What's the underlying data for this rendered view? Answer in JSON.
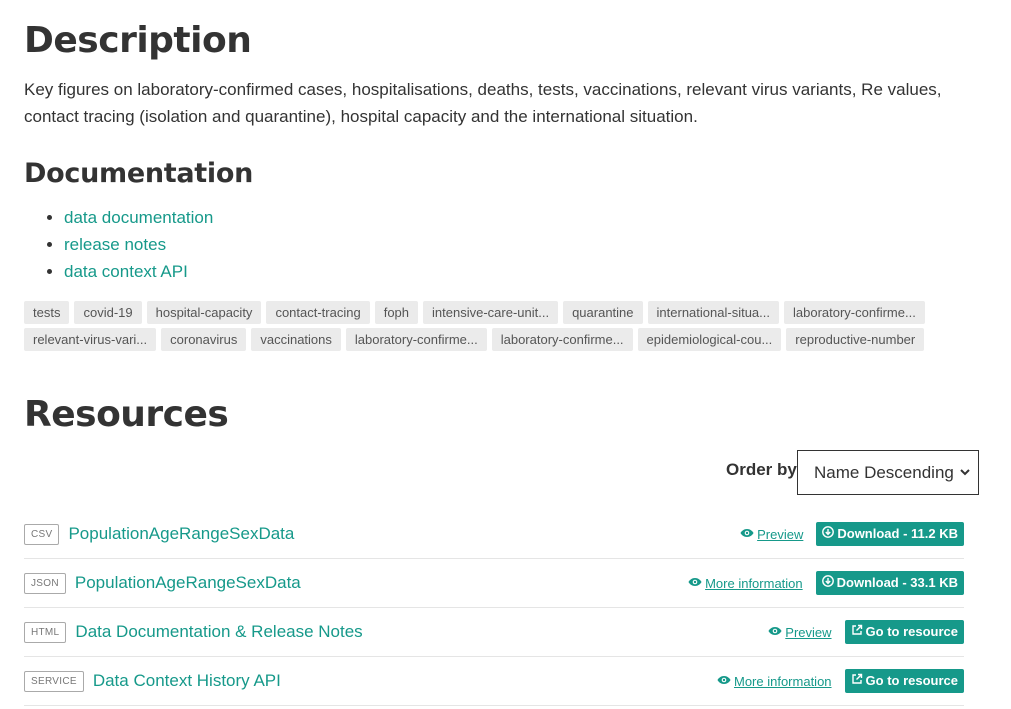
{
  "description": {
    "heading": "Description",
    "text": "Key figures on laboratory-confirmed cases, hospitalisations, deaths, tests, vaccinations, relevant virus variants, Re values, contact tracing (isolation and quarantine), hospital capacity and the international situation."
  },
  "documentation": {
    "heading": "Documentation",
    "links": [
      "data documentation",
      "release notes",
      "data context API"
    ]
  },
  "tags": [
    "tests",
    "covid-19",
    "hospital-capacity",
    "contact-tracing",
    "foph",
    "intensive-care-unit...",
    "quarantine",
    "international-situa...",
    "laboratory-confirme...",
    "relevant-virus-vari...",
    "coronavirus",
    "vaccinations",
    "laboratory-confirme...",
    "laboratory-confirme...",
    "epidemiological-cou...",
    "reproductive-number"
  ],
  "resources": {
    "heading": "Resources",
    "order_label": "Order by",
    "order_value": "Name Descending",
    "items": [
      {
        "format": "CSV",
        "title": "PopulationAgeRangeSexData",
        "action": "Preview",
        "button": "Download - 11.2 KB"
      },
      {
        "format": "JSON",
        "title": "PopulationAgeRangeSexData",
        "action": "More information",
        "button": "Download - 33.1 KB"
      },
      {
        "format": "HTML",
        "title": "Data Documentation & Release Notes",
        "action": "Preview",
        "button": "Go to resource"
      },
      {
        "format": "SERVICE",
        "title": "Data Context History API",
        "action": "More information",
        "button": "Go to resource"
      }
    ]
  },
  "icons": {
    "eye": "eye-icon",
    "download": "download-icon",
    "external": "external-link-icon",
    "chevron": "chevron-down-icon"
  },
  "colors": {
    "accent": "#16998a",
    "tag_bg": "#ebebeb"
  }
}
